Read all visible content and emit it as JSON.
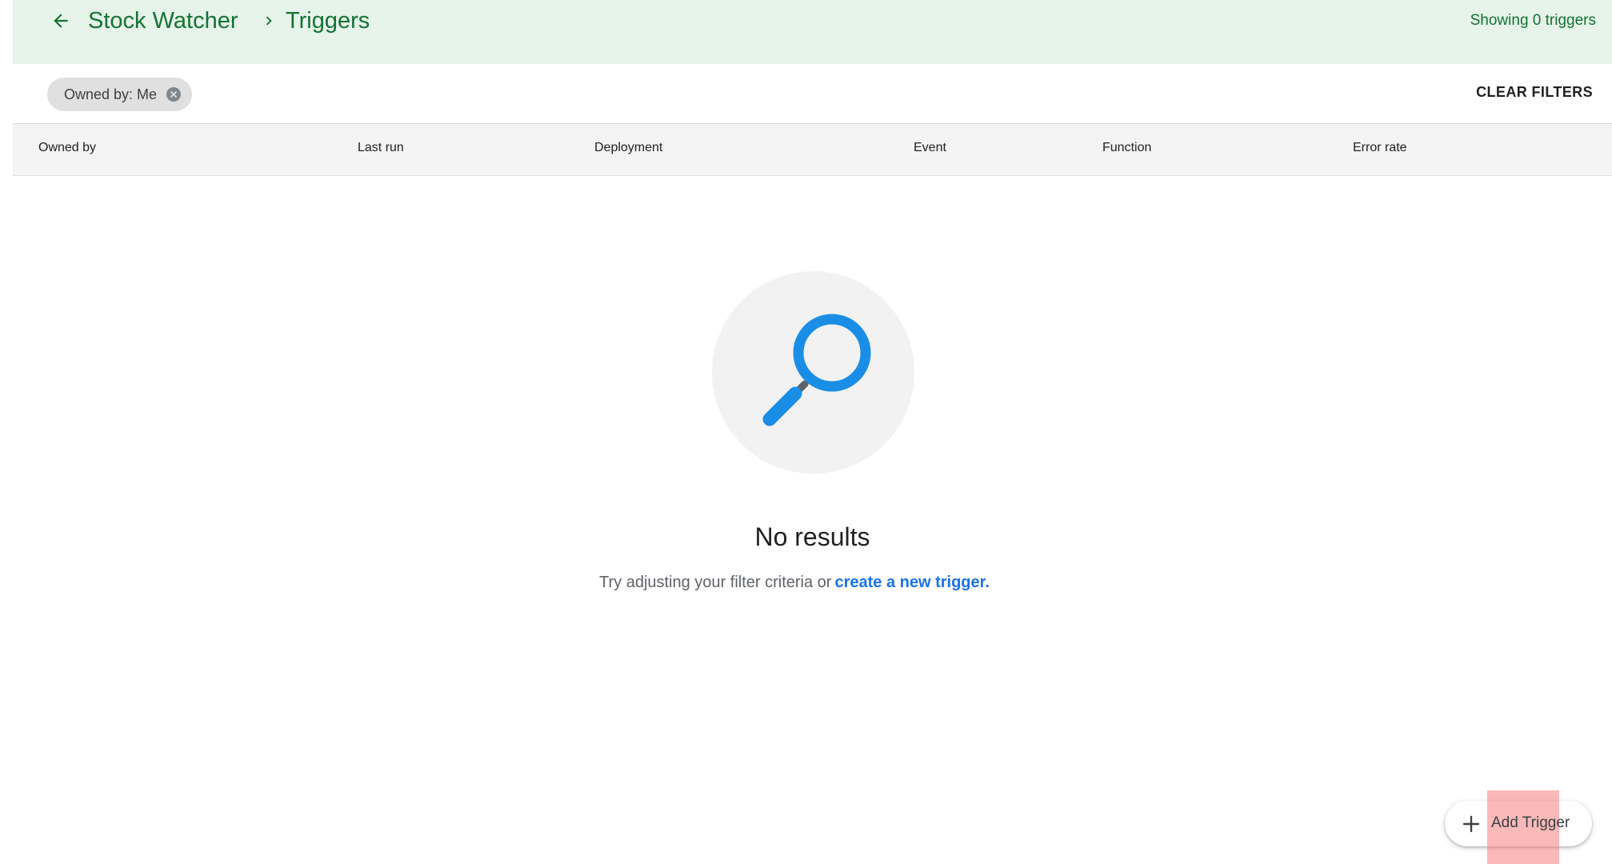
{
  "header": {
    "breadcrumb": {
      "app": "Stock Watcher",
      "current": "Triggers"
    },
    "showing_count": "Showing 0 triggers"
  },
  "filters": {
    "chip_label": "Owned by: Me",
    "clear_label": "CLEAR FILTERS"
  },
  "table": {
    "columns": [
      "Owned by",
      "Last run",
      "Deployment",
      "Event",
      "Function",
      "Error rate"
    ]
  },
  "empty_state": {
    "title": "No results",
    "message": "Try adjusting your filter criteria or",
    "link": "create a new trigger."
  },
  "fab": {
    "label": "Add Trigger"
  },
  "colors": {
    "header_bg": "#e6f4ea",
    "brand_green": "#137333",
    "link_blue": "#1a73e8",
    "magnifier_blue": "#1a8ee6"
  },
  "icons": [
    "arrow-back-icon",
    "chevron-right-icon",
    "close-circle-icon",
    "magnifier-icon",
    "plus-icon"
  ]
}
